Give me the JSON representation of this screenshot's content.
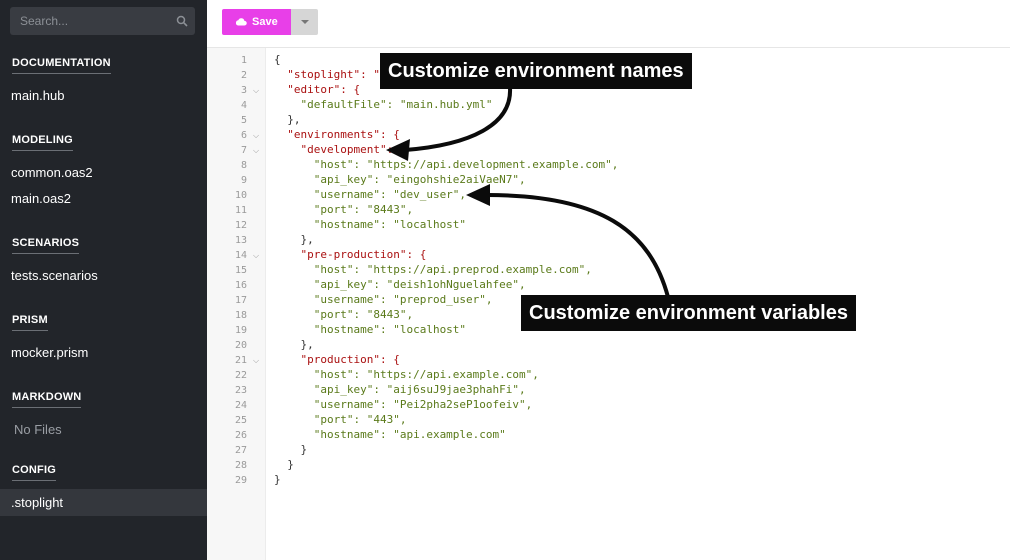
{
  "sidebar": {
    "search_placeholder": "Search...",
    "sections": [
      {
        "title": "DOCUMENTATION",
        "items": [
          "main.hub"
        ]
      },
      {
        "title": "MODELING",
        "items": [
          "common.oas2",
          "main.oas2"
        ]
      },
      {
        "title": "SCENARIOS",
        "items": [
          "tests.scenarios"
        ]
      },
      {
        "title": "PRISM",
        "items": [
          "mocker.prism"
        ]
      },
      {
        "title": "MARKDOWN",
        "items": [
          "No Files"
        ]
      },
      {
        "title": "CONFIG",
        "items": [
          ".stoplight"
        ]
      }
    ]
  },
  "toolbar": {
    "save_label": "Save"
  },
  "editor": {
    "line_numbers": [
      "1",
      "2",
      "3",
      "4",
      "5",
      "6",
      "7",
      "8",
      "9",
      "10",
      "11",
      "12",
      "13",
      "14",
      "15",
      "16",
      "17",
      "18",
      "19",
      "20",
      "21",
      "22",
      "23",
      "24",
      "25",
      "26",
      "27",
      "28",
      "29"
    ],
    "lines": [
      "{",
      "  \"stoplight\": \"",
      "  \"editor\": {",
      "    \"defaultFile\": \"main.hub.yml\"",
      "  },",
      "  \"environments\": {",
      "    \"development\": {",
      "      \"host\": \"https://api.development.example.com\",",
      "      \"api_key\": \"eingohshie2aiVaeN7\",",
      "      \"username\": \"dev_user\",",
      "      \"port\": \"8443\",",
      "      \"hostname\": \"localhost\"",
      "    },",
      "    \"pre-production\": {",
      "      \"host\": \"https://api.preprod.example.com\",",
      "      \"api_key\": \"deish1ohNguelahfee\",",
      "      \"username\": \"preprod_user\",",
      "      \"port\": \"8443\",",
      "      \"hostname\": \"localhost\"",
      "    },",
      "    \"production\": {",
      "      \"host\": \"https://api.example.com\",",
      "      \"api_key\": \"aij6suJ9jae3phahFi\",",
      "      \"username\": \"Pei2pha2seP1oofeiv\",",
      "      \"port\": \"443\",",
      "      \"hostname\": \"api.example.com\"",
      "    }",
      "  }",
      "}"
    ]
  },
  "callouts": {
    "names": "Customize environment names",
    "variables": "Customize environment variables"
  }
}
